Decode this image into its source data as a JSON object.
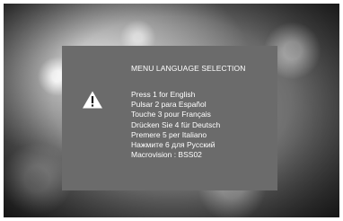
{
  "dialog": {
    "title": "MENU LANGUAGE SELECTION",
    "icon": "warning-icon",
    "options": [
      "Press 1 for English",
      "Pulsar 2 para Español",
      "Touche 3 pour Français",
      "Drücken Sie 4 für Deutsch",
      "Premere 5 per Italiano",
      "Нажмите 6 для Русский",
      "Macrovision : BSS02"
    ]
  },
  "colors": {
    "panel": "#6b6b6b",
    "text": "#ffffff"
  }
}
